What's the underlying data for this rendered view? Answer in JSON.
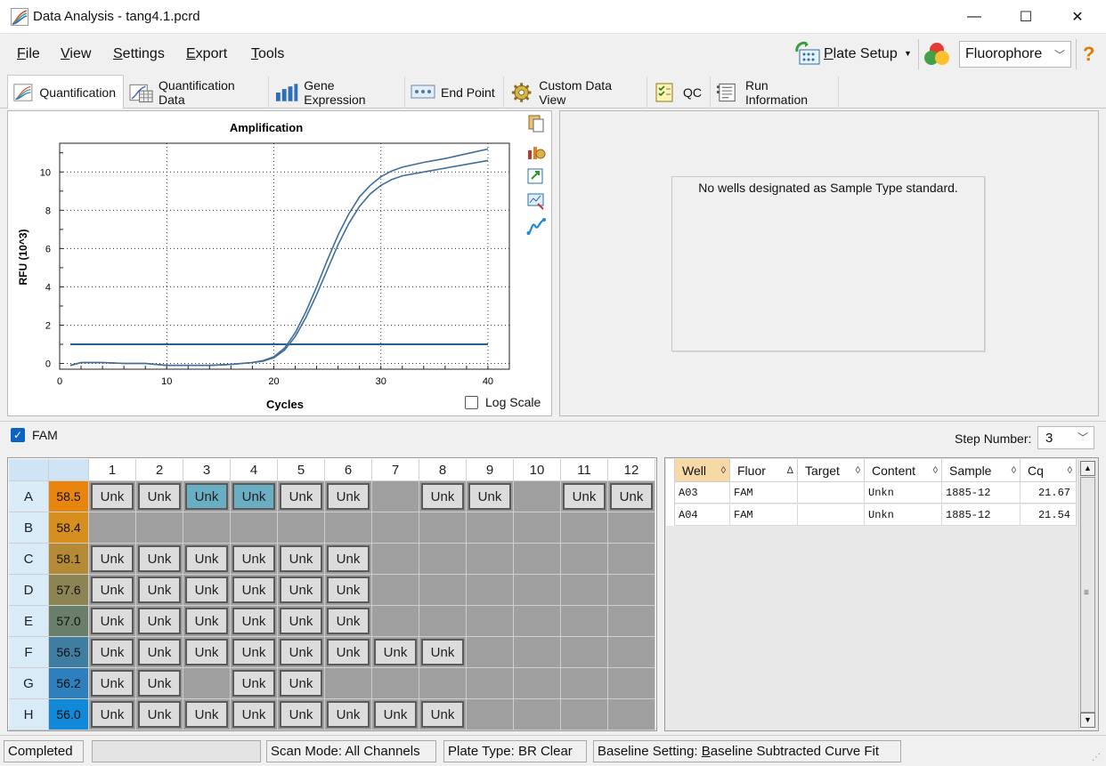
{
  "window": {
    "title": "Data Analysis - tang4.1.pcrd",
    "minimize": "—",
    "maximize": "☐",
    "close": "✕"
  },
  "menu": {
    "items": [
      {
        "label": "File",
        "key": "F",
        "rest": "ile"
      },
      {
        "label": "View",
        "key": "V",
        "rest": "iew"
      },
      {
        "label": "Settings",
        "key": "S",
        "rest": "ettings"
      },
      {
        "label": "Export",
        "key": "E",
        "rest": "xport"
      },
      {
        "label": "Tools",
        "key": "T",
        "rest": "ools"
      }
    ],
    "plate_setup": "Plate Setup",
    "plate_setup_key": "P",
    "plate_setup_rest": "late Setup",
    "fluorophore_select": "Fluorophore",
    "help": "?"
  },
  "tabs": [
    {
      "label": "Quantification",
      "icon": "amplification-icon",
      "active": true
    },
    {
      "label": "Quantification Data",
      "icon": "data-table-icon"
    },
    {
      "label": "Gene Expression",
      "icon": "bar-chart-icon"
    },
    {
      "label": "End Point",
      "icon": "endpoint-icon"
    },
    {
      "label": "Custom Data View",
      "icon": "gear-icon"
    },
    {
      "label": "QC",
      "icon": "checklist-icon"
    },
    {
      "label": "Run Information",
      "icon": "run-info-icon"
    }
  ],
  "chart_data": {
    "type": "line",
    "title": "Amplification",
    "xlabel": "Cycles",
    "ylabel": "RFU (10^3)",
    "xlim": [
      0,
      42
    ],
    "ylim": [
      -0.3,
      11.5
    ],
    "xticks": [
      0,
      10,
      20,
      30,
      40
    ],
    "yticks": [
      0,
      2,
      4,
      6,
      8,
      10
    ],
    "grid": true,
    "threshold": 1.0,
    "series": [
      {
        "x": [
          1,
          2,
          4,
          6,
          8,
          10,
          12,
          14,
          16,
          18,
          19,
          20,
          21,
          22,
          23,
          24,
          25,
          26,
          27,
          28,
          29,
          30,
          31,
          32,
          34,
          36,
          38,
          40
        ],
        "y": [
          -0.1,
          0.05,
          0.05,
          0.0,
          0.0,
          -0.1,
          -0.1,
          -0.1,
          -0.05,
          0.05,
          0.15,
          0.35,
          0.8,
          1.6,
          2.7,
          4.0,
          5.4,
          6.7,
          7.8,
          8.7,
          9.3,
          9.75,
          10.05,
          10.25,
          10.5,
          10.7,
          10.95,
          11.2
        ]
      },
      {
        "x": [
          1,
          2,
          4,
          6,
          8,
          10,
          12,
          14,
          16,
          18,
          19,
          20,
          21,
          22,
          23,
          24,
          25,
          26,
          27,
          28,
          29,
          30,
          31,
          32,
          34,
          36,
          38,
          40
        ],
        "y": [
          -0.1,
          0.05,
          0.05,
          0.0,
          0.0,
          -0.1,
          -0.1,
          -0.1,
          -0.05,
          0.05,
          0.12,
          0.3,
          0.7,
          1.4,
          2.4,
          3.6,
          4.9,
          6.2,
          7.3,
          8.2,
          8.85,
          9.3,
          9.6,
          9.8,
          10.0,
          10.2,
          10.4,
          10.6
        ]
      }
    ],
    "log_scale_label": "Log Scale",
    "log_scale_checked": false
  },
  "standard_curve": {
    "message": "No wells designated as Sample Type standard."
  },
  "fluor_toggle": {
    "label": "FAM",
    "checked": true
  },
  "step": {
    "label": "Step Number:",
    "value": "3"
  },
  "plate": {
    "columns": [
      "1",
      "2",
      "3",
      "4",
      "5",
      "6",
      "7",
      "8",
      "9",
      "10",
      "11",
      "12"
    ],
    "rows": [
      {
        "label": "A",
        "temp": "58.5",
        "temp_color": "#e8850f",
        "wells": [
          "Unk",
          "Unk",
          "Unk*",
          "Unk*",
          "Unk",
          "Unk",
          "",
          "Unk",
          "Unk",
          "",
          "Unk",
          "Unk"
        ]
      },
      {
        "label": "B",
        "temp": "58.4",
        "temp_color": "#d58f1e",
        "wells": [
          "",
          "",
          "",
          "",
          "",
          "",
          "",
          "",
          "",
          "",
          "",
          ""
        ]
      },
      {
        "label": "C",
        "temp": "58.1",
        "temp_color": "#b58a37",
        "wells": [
          "Unk",
          "Unk",
          "Unk",
          "Unk",
          "Unk",
          "Unk",
          "",
          "",
          "",
          "",
          "",
          ""
        ]
      },
      {
        "label": "D",
        "temp": "57.6",
        "temp_color": "#8c8453",
        "wells": [
          "Unk",
          "Unk",
          "Unk",
          "Unk",
          "Unk",
          "Unk",
          "",
          "",
          "",
          "",
          "",
          ""
        ]
      },
      {
        "label": "E",
        "temp": "57.0",
        "temp_color": "#6a7f6a",
        "wells": [
          "Unk",
          "Unk",
          "Unk",
          "Unk",
          "Unk",
          "Unk",
          "",
          "",
          "",
          "",
          "",
          ""
        ]
      },
      {
        "label": "F",
        "temp": "56.5",
        "temp_color": "#3f7ea0",
        "wells": [
          "Unk",
          "Unk",
          "Unk",
          "Unk",
          "Unk",
          "Unk",
          "Unk",
          "Unk",
          "",
          "",
          "",
          ""
        ]
      },
      {
        "label": "G",
        "temp": "56.2",
        "temp_color": "#2e7fbd",
        "wells": [
          "Unk",
          "Unk",
          "",
          "Unk",
          "Unk",
          "",
          "",
          "",
          "",
          "",
          "",
          ""
        ]
      },
      {
        "label": "H",
        "temp": "56.0",
        "temp_color": "#1288d8",
        "wells": [
          "Unk",
          "Unk",
          "Unk",
          "Unk",
          "Unk",
          "Unk",
          "Unk",
          "Unk",
          "",
          "",
          "",
          ""
        ]
      }
    ]
  },
  "results": {
    "headers": [
      {
        "label": "Well",
        "sort": "◊",
        "sorted": true
      },
      {
        "label": "Fluor",
        "sort": "Δ"
      },
      {
        "label": "Target",
        "sort": "◊"
      },
      {
        "label": "Content",
        "sort": "◊"
      },
      {
        "label": "Sample",
        "sort": "◊"
      },
      {
        "label": "Cq",
        "sort": "◊"
      }
    ],
    "rows": [
      [
        "A03",
        "FAM",
        "",
        "Unkn",
        "1885-12",
        "21.67"
      ],
      [
        "A04",
        "FAM",
        "",
        "Unkn",
        "1885-12",
        "21.54"
      ]
    ]
  },
  "status": {
    "state": "Completed",
    "scan_mode": "Scan Mode: All Channels",
    "plate_type": "Plate Type: BR Clear",
    "baseline_prefix": "Baseline Setting: ",
    "baseline_key": "B",
    "baseline_rest": "aseline Subtracted Curve Fit"
  },
  "colors": {
    "accent": "#0b63c5",
    "curve": "#3f6e9c",
    "threshold": "#2b5f91",
    "well_gray": "#9f9f9f",
    "selected_well": "#6aaec4"
  }
}
